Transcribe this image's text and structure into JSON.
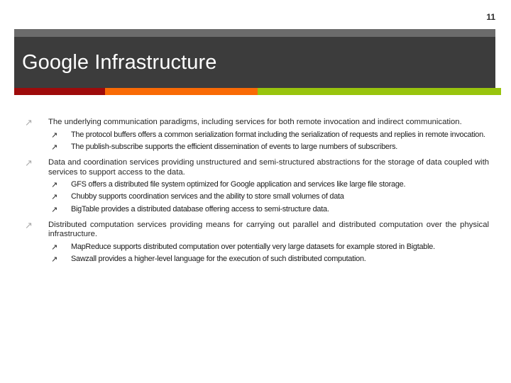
{
  "slide": {
    "page_number": "11",
    "title": "Google Infrastructure",
    "accent_colors": {
      "red": "#9e0b0b",
      "orange": "#f96a05",
      "green": "#98c40d",
      "header_dark": "#3c3c3c",
      "header_light": "#6b6b6b"
    },
    "bullet_glyph_level1": "arrow-up-right-icon",
    "bullet_glyph_level2": "arrow-up-right-icon",
    "bullet_char": "↗"
  },
  "content": {
    "groups": [
      {
        "heading": "The underlying communication paradigms, including services for both remote invocation and indirect communication.",
        "items": [
          "The protocol buffers offers a common serialization format including the serialization of requests and replies in remote invocation.",
          "The publish-subscribe supports the efficient dissemination of events to large numbers of subscribers."
        ]
      },
      {
        "heading": "Data and coordination services providing unstructured and semi-structured abstractions for the storage of data coupled with services to support access to the data.",
        "items": [
          "GFS offers a distributed file system optimized for Google application and services like large file storage.",
          "Chubby supports coordination services and the ability to store small volumes of data",
          "BigTable provides a distributed database offering access to semi-structure data."
        ]
      },
      {
        "heading": "Distributed computation services providing means for carrying out parallel and distributed computation over the physical infrastructure.",
        "items": [
          "MapReduce supports distributed computation over potentially very large datasets for example stored in Bigtable.",
          "Sawzall provides a higher-level language for the execution of such distributed computation."
        ]
      }
    ]
  }
}
